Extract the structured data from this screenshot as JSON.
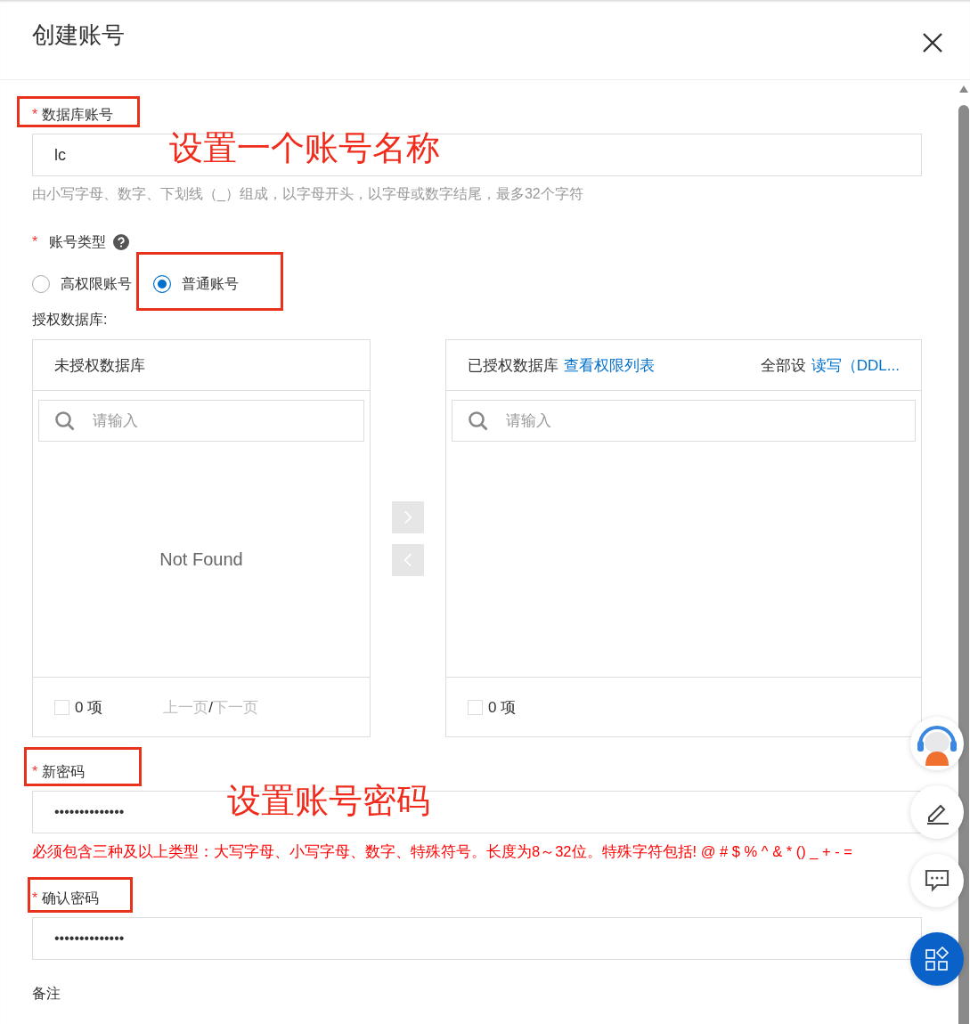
{
  "dialog": {
    "title": "创建账号"
  },
  "account": {
    "label": "数据库账号",
    "required_mark": "*",
    "annotated": true,
    "value": "lc",
    "note": "设置一个账号名称",
    "hint": "由小写字母、数字、下划线（_）组成，以字母开头，以字母或数字结尾，最多32个字符"
  },
  "account_type": {
    "label": "账号类型",
    "required_mark": "*",
    "options": [
      {
        "label": "高权限账号",
        "selected": false
      },
      {
        "label": "普通账号",
        "selected": true,
        "annotated": true
      }
    ]
  },
  "databases": {
    "label": "授权数据库:",
    "left": {
      "title": "未授权数据库",
      "search_placeholder": "请输入",
      "empty": "Not Found",
      "count": "0 项",
      "checked": false,
      "pager": {
        "prev": "上一页",
        "sep": "/",
        "next": "下一页"
      }
    },
    "right": {
      "title": "已授权数据库",
      "link": "查看权限列表",
      "set_all": "全部设",
      "set_link": "读写（DDL...",
      "search_placeholder": "请输入",
      "count": "0 项",
      "checked": false
    }
  },
  "password": {
    "label": "新密码",
    "required_mark": "*",
    "annotated": true,
    "value": "••••••••••••••",
    "note": "设置账号密码",
    "rule": "必须包含三种及以上类型：大写字母、小写字母、数字、特殊符号。长度为8～32位。特殊字符包括! @ # $ % ^ & * () _ + - ="
  },
  "confirm": {
    "label": "确认密码",
    "required_mark": "*",
    "annotated": true,
    "value": "••••••••••••••"
  },
  "remark": {
    "label": "备注"
  },
  "side_tools": [
    {
      "kind": "assistant",
      "selected": false
    },
    {
      "kind": "edit",
      "selected": false
    },
    {
      "kind": "chat",
      "selected": false
    },
    {
      "kind": "apps",
      "selected": true
    }
  ]
}
